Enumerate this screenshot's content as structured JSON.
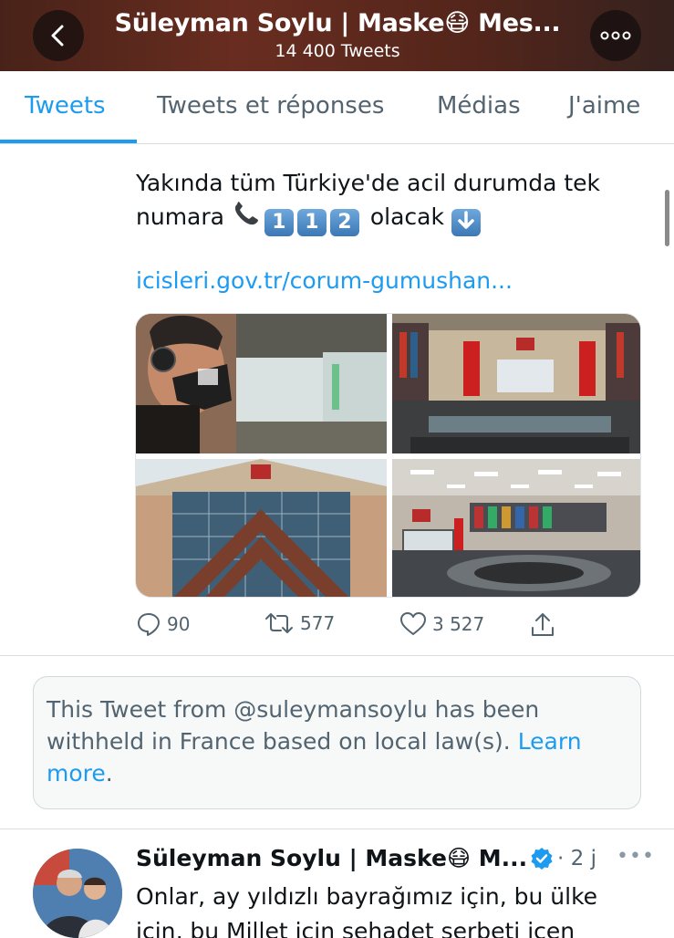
{
  "header": {
    "title": "Süleyman Soylu | Maske😷 Mes...",
    "subtitle": "14 400 Tweets",
    "back_icon": "chevron-left-icon",
    "more_icon": "more-dots-icon"
  },
  "tabs": [
    {
      "label": "Tweets",
      "active": true
    },
    {
      "label": "Tweets et réponses",
      "active": false
    },
    {
      "label": "Médias",
      "active": false
    },
    {
      "label": "J'aime",
      "active": false
    }
  ],
  "tweet1": {
    "text_line1": "Yakında tüm Türkiye'de acil durumda tek",
    "text_line2_prefix": "numara",
    "digits": [
      "1",
      "1",
      "2"
    ],
    "text_line2_suffix": "olacak",
    "link": "icisleri.gov.tr/corum-gumushan...",
    "media_badge": "112",
    "stats": {
      "replies": "90",
      "retweets": "577",
      "likes": "3 527"
    }
  },
  "withheld": {
    "text": "This Tweet from @suleymansoylu has been withheld in France based on local law(s). ",
    "link_text": "Learn more",
    "period": "."
  },
  "tweet2": {
    "name": "Süleyman Soylu | Maske😷  M...",
    "time": "· 2 j",
    "dots": "•••",
    "text": "Onlar, ay yıldızlı bayrağımız için, bu ülke için, bu Millet için şehadet şerbeti içen"
  },
  "colors": {
    "accent": "#1d9bf0",
    "secondary_text": "#536471",
    "verified": "#1d9bf0"
  }
}
